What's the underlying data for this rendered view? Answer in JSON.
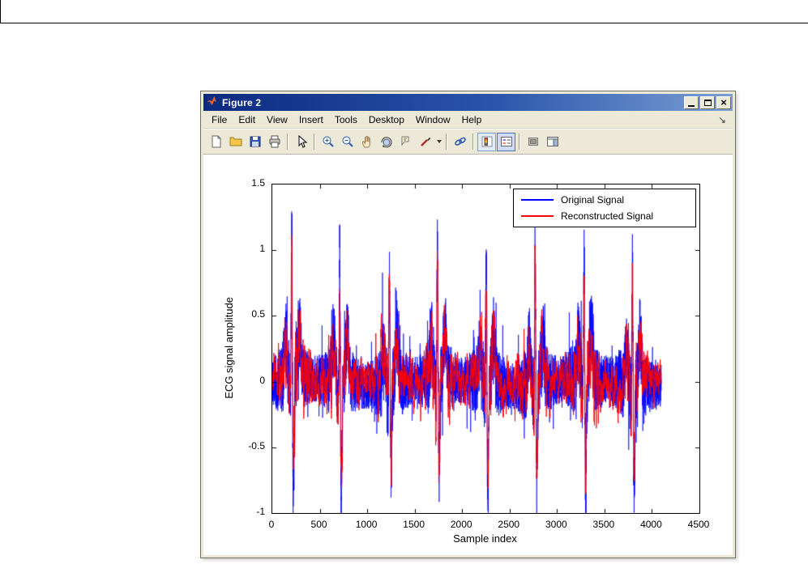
{
  "window": {
    "title": "Figure 2",
    "controls": {
      "close_glyph": "×"
    },
    "chrome_color": "#ECE9D8",
    "titlebar_gradient": [
      "#0b2a80",
      "#7a9fd4"
    ]
  },
  "menubar": {
    "items": [
      "File",
      "Edit",
      "View",
      "Insert",
      "Tools",
      "Desktop",
      "Window",
      "Help"
    ],
    "dock_glyph": "↘"
  },
  "toolbar": {
    "icons": [
      "new-figure-icon",
      "open-file-icon",
      "save-icon",
      "print-icon",
      "edit-plot-icon",
      "zoom-in-icon",
      "zoom-out-icon",
      "pan-icon",
      "rotate-3d-icon",
      "data-cursor-icon",
      "brush-icon",
      "brush-dropdown-arrow",
      "link-plot-icon",
      "insert-colorbar-icon",
      "insert-legend-icon",
      "hide-plot-tools-icon",
      "show-plot-tools-icon"
    ],
    "active_icon": "insert-legend-icon"
  },
  "chart_data": {
    "type": "line",
    "title": "",
    "xlabel": "Sample index",
    "ylabel": "ECG signal amplitude",
    "xlim": [
      0,
      4500
    ],
    "ylim": [
      -1,
      1.5
    ],
    "xticks": [
      0,
      500,
      1000,
      1500,
      2000,
      2500,
      3000,
      3500,
      4000,
      4500
    ],
    "yticks": [
      -1,
      -0.5,
      0,
      0.5,
      1,
      1.5
    ],
    "grid": false,
    "legend_position": "top-right",
    "plot_background": "#ffffff",
    "n_samples": 4100,
    "beats": {
      "centers": [
        205,
        710,
        1235,
        1740,
        2255,
        2770,
        3285,
        3795
      ],
      "r_peaks": [
        1.22,
        1.05,
        0.98,
        1.17,
        1.05,
        1.06,
        1.01,
        0.97
      ],
      "s_troughs": [
        -0.95,
        -0.8,
        -0.62,
        -0.7,
        -0.85,
        -0.75,
        -0.8,
        -0.78
      ]
    },
    "series": [
      {
        "name": "Original Signal",
        "color": "#0000ff",
        "noise_amplitude": 0.16,
        "peak_scale": 1.0
      },
      {
        "name": "Reconstructed Signal",
        "color": "#ff0000",
        "noise_amplitude": 0.08,
        "peak_scale": 0.85
      }
    ]
  }
}
